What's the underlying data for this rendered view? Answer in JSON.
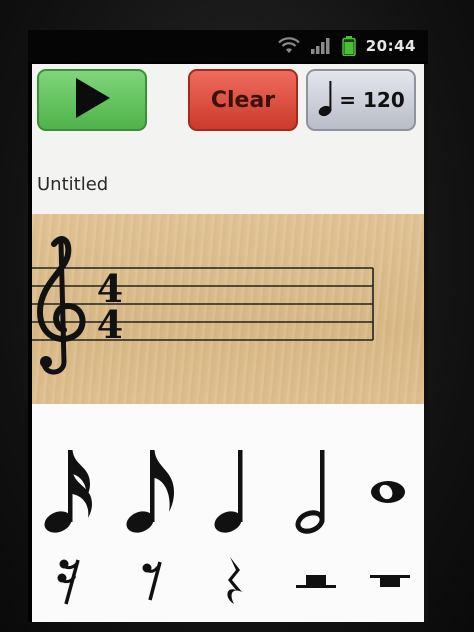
{
  "status_bar": {
    "time": "20:44",
    "icons": [
      "wifi-icon",
      "signal-icon",
      "battery-icon"
    ],
    "battery_color": "#4cbf3a"
  },
  "toolbar": {
    "play_icon": "play-icon",
    "clear_label": "Clear",
    "tempo_note_icon": "quarter-note-icon",
    "tempo_label": "= 120"
  },
  "song": {
    "title": "Untitled"
  },
  "staff": {
    "clef": "treble-clef-icon",
    "time_signature": {
      "numerator": "4",
      "denominator": "4"
    }
  },
  "palette": {
    "notes": [
      "sixteenth-note-icon",
      "eighth-note-icon",
      "quarter-note-icon",
      "half-note-icon",
      "whole-note-icon"
    ],
    "rests": [
      "sixteenth-rest-icon",
      "eighth-rest-icon",
      "quarter-rest-icon",
      "half-rest-icon",
      "whole-rest-icon"
    ]
  },
  "colors": {
    "play": "#5cc456",
    "clear": "#e04a3a",
    "tempo": "#cfd2da",
    "staff_background": "#dcbc89"
  }
}
